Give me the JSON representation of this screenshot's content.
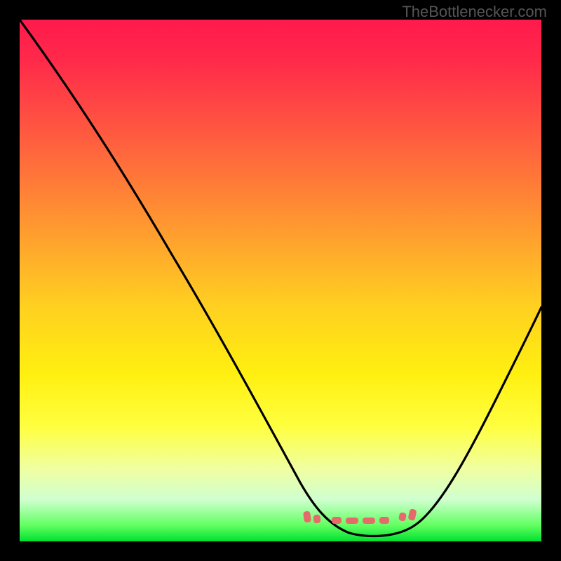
{
  "watermark": "TheBottlenecker.com",
  "colors": {
    "gradient_top": "#ff1a4c",
    "gradient_mid": "#ffe010",
    "gradient_bottom": "#00e030",
    "curve": "#000000",
    "marker": "#e56b6b",
    "frame": "#000000"
  },
  "chart_data": {
    "type": "line",
    "title": "",
    "xlabel": "",
    "ylabel": "",
    "x": [
      0,
      5,
      10,
      15,
      20,
      25,
      30,
      35,
      40,
      45,
      50,
      55,
      58,
      62,
      66,
      70,
      75,
      80,
      85,
      90,
      95,
      100
    ],
    "values": [
      100,
      92,
      84,
      77,
      69,
      61,
      53,
      45,
      37,
      29,
      20,
      11,
      5,
      1,
      0,
      0,
      2,
      8,
      17,
      28,
      41,
      56
    ],
    "xlim": [
      0,
      100
    ],
    "ylim": [
      0,
      100
    ],
    "marker_range_x": [
      58,
      78
    ],
    "note": "V-shaped bottleneck curve; optimum (y≈0) around x≈64–72; marker band highlights valley"
  }
}
